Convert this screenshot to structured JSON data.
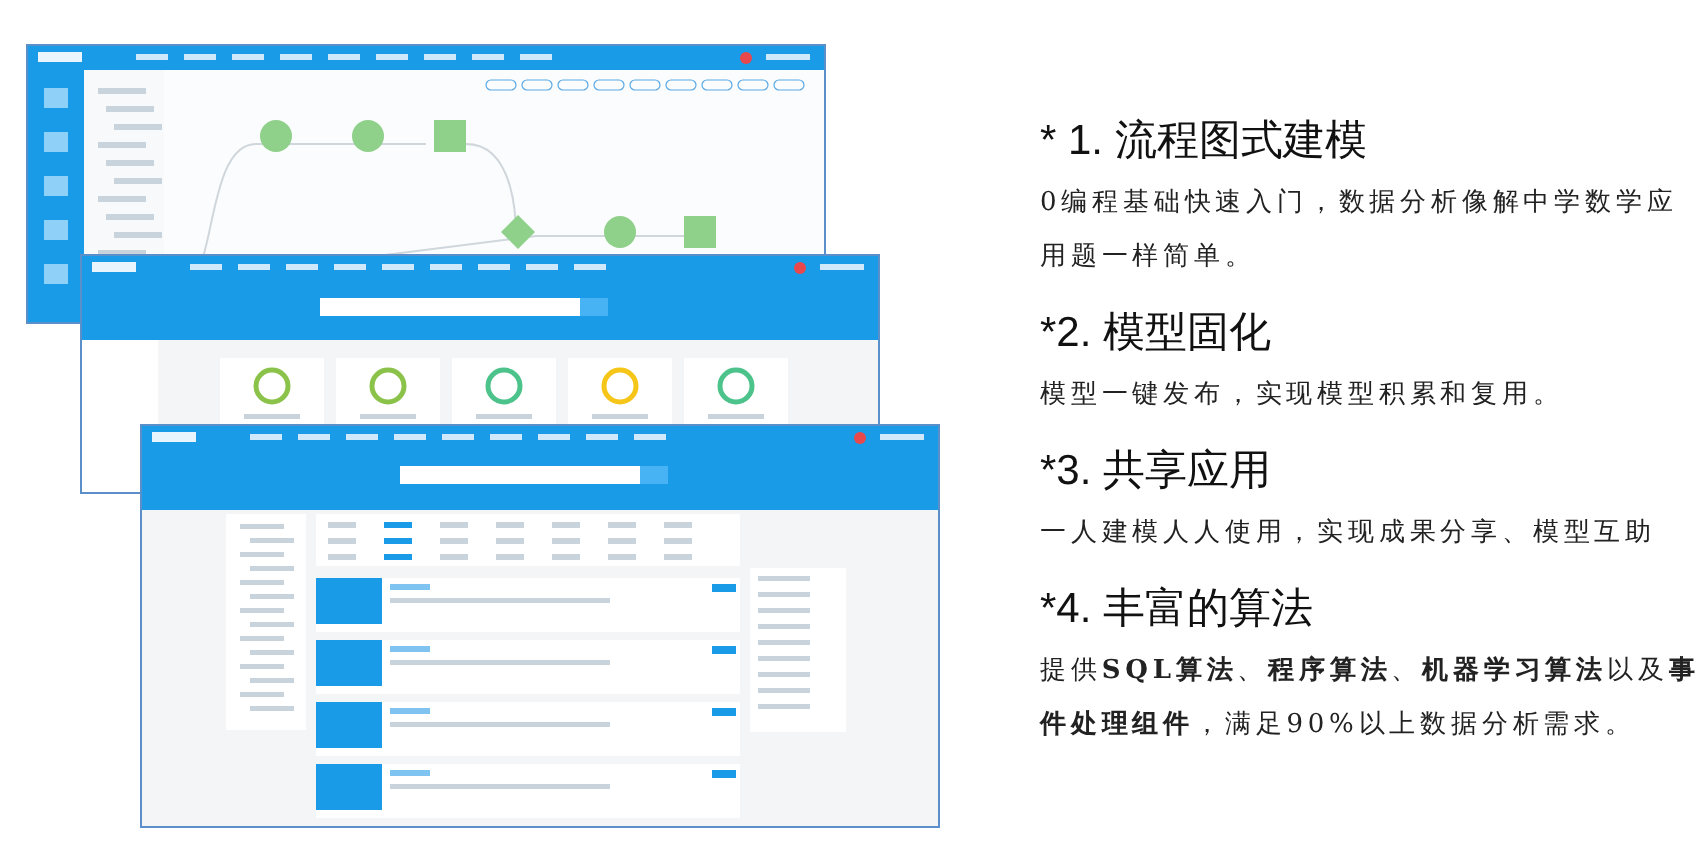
{
  "screenshots": [
    {
      "kind": "flow"
    },
    {
      "kind": "cards"
    },
    {
      "kind": "market"
    }
  ],
  "features": [
    {
      "heading": "* 1. 流程图式建模",
      "body": "0编程基础快速入门，数据分析像解中学数学应用题一样简单。"
    },
    {
      "heading": "*2. 模型固化",
      "body": "模型一键发布，实现模型积累和复用。"
    },
    {
      "heading": "*3. 共享应用",
      "body": "一人建模人人使用，实现成果分享、模型互助"
    },
    {
      "heading": "*4. 丰富的算法",
      "body": "提供**SQL算法**、**程序算法**、**机器学习算法**以及**事件处理组件**，满足90%以上数据分析需求。"
    }
  ]
}
